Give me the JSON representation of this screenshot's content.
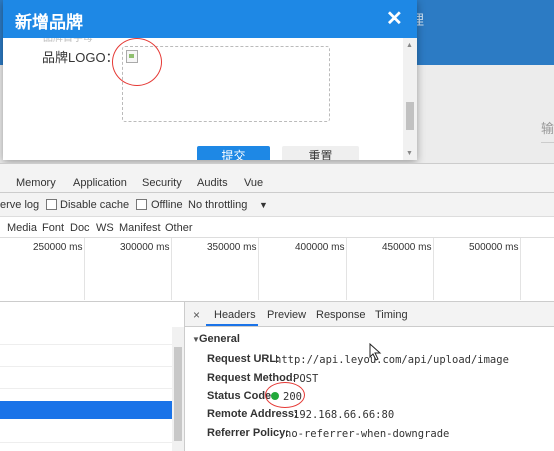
{
  "background_app": {
    "header_text": "理",
    "right_text": "输"
  },
  "dialog": {
    "title": "新增品牌",
    "close_glyph": "✕",
    "overflow_text": "品牌首字母",
    "logo_label": "品牌LOGO：",
    "submit_label": "提交",
    "reset_label": "重置"
  },
  "devtools": {
    "tabs": [
      "Memory",
      "Application",
      "Security",
      "Audits",
      "Vue"
    ],
    "toolbar": {
      "preserve_log": "erve log",
      "disable_cache": "Disable cache",
      "offline": "Offline",
      "throttling": "No throttling",
      "throttling_arrow": "▼"
    },
    "filters": [
      "Media",
      "Font",
      "Doc",
      "WS",
      "Manifest",
      "Other"
    ],
    "timeline": [
      "250000 ms",
      "300000 ms",
      "350000 ms",
      "400000 ms",
      "450000 ms",
      "500000 ms"
    ],
    "detail_tabs": {
      "close": "×",
      "items": [
        "Headers",
        "Preview",
        "Response",
        "Timing"
      ]
    },
    "general": {
      "title": "General",
      "rows": [
        {
          "key": "Request URL:",
          "value": "http://api.leyou.com/api/upload/image"
        },
        {
          "key": "Request Method:",
          "value": "POST"
        },
        {
          "key": "Status Code:",
          "value": "200"
        },
        {
          "key": "Remote Address:",
          "value": "192.168.66.66:80"
        },
        {
          "key": "Referrer Policy:",
          "value": "no-referrer-when-downgrade"
        }
      ]
    }
  },
  "colors": {
    "accent": "#1e88e5",
    "selection": "#1a73e8",
    "annotation": "#e53935",
    "status_ok": "#22a83a"
  }
}
